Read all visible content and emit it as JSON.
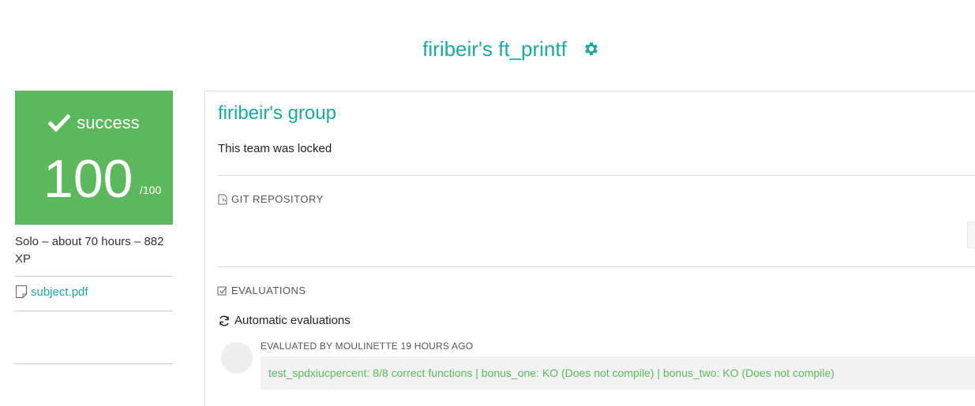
{
  "header": {
    "title": "firibeir's ft_printf",
    "settings_icon": "gear-icon"
  },
  "score": {
    "status": "success",
    "value": "100",
    "max": "/100",
    "color": "#5cb85c"
  },
  "meta": {
    "text": "Solo – about 70 hours – 882 XP"
  },
  "subject": {
    "label": "subject.pdf"
  },
  "team": {
    "name": "firibeir's group",
    "locked_text": "This team was locked"
  },
  "sections": {
    "git": "GIT REPOSITORY",
    "evaluations": "EVALUATIONS"
  },
  "evaluation": {
    "heading": "Automatic evaluations",
    "meta": "EVALUATED BY MOULINETTE 19 HOURS AGO",
    "result": "test_spdxiucpercent: 8/8 correct functions | bonus_one: KO (Does not compile) | bonus_two: KO (Does not compile)"
  },
  "colors": {
    "accent": "#1aa8a3",
    "success": "#5cb85c"
  }
}
